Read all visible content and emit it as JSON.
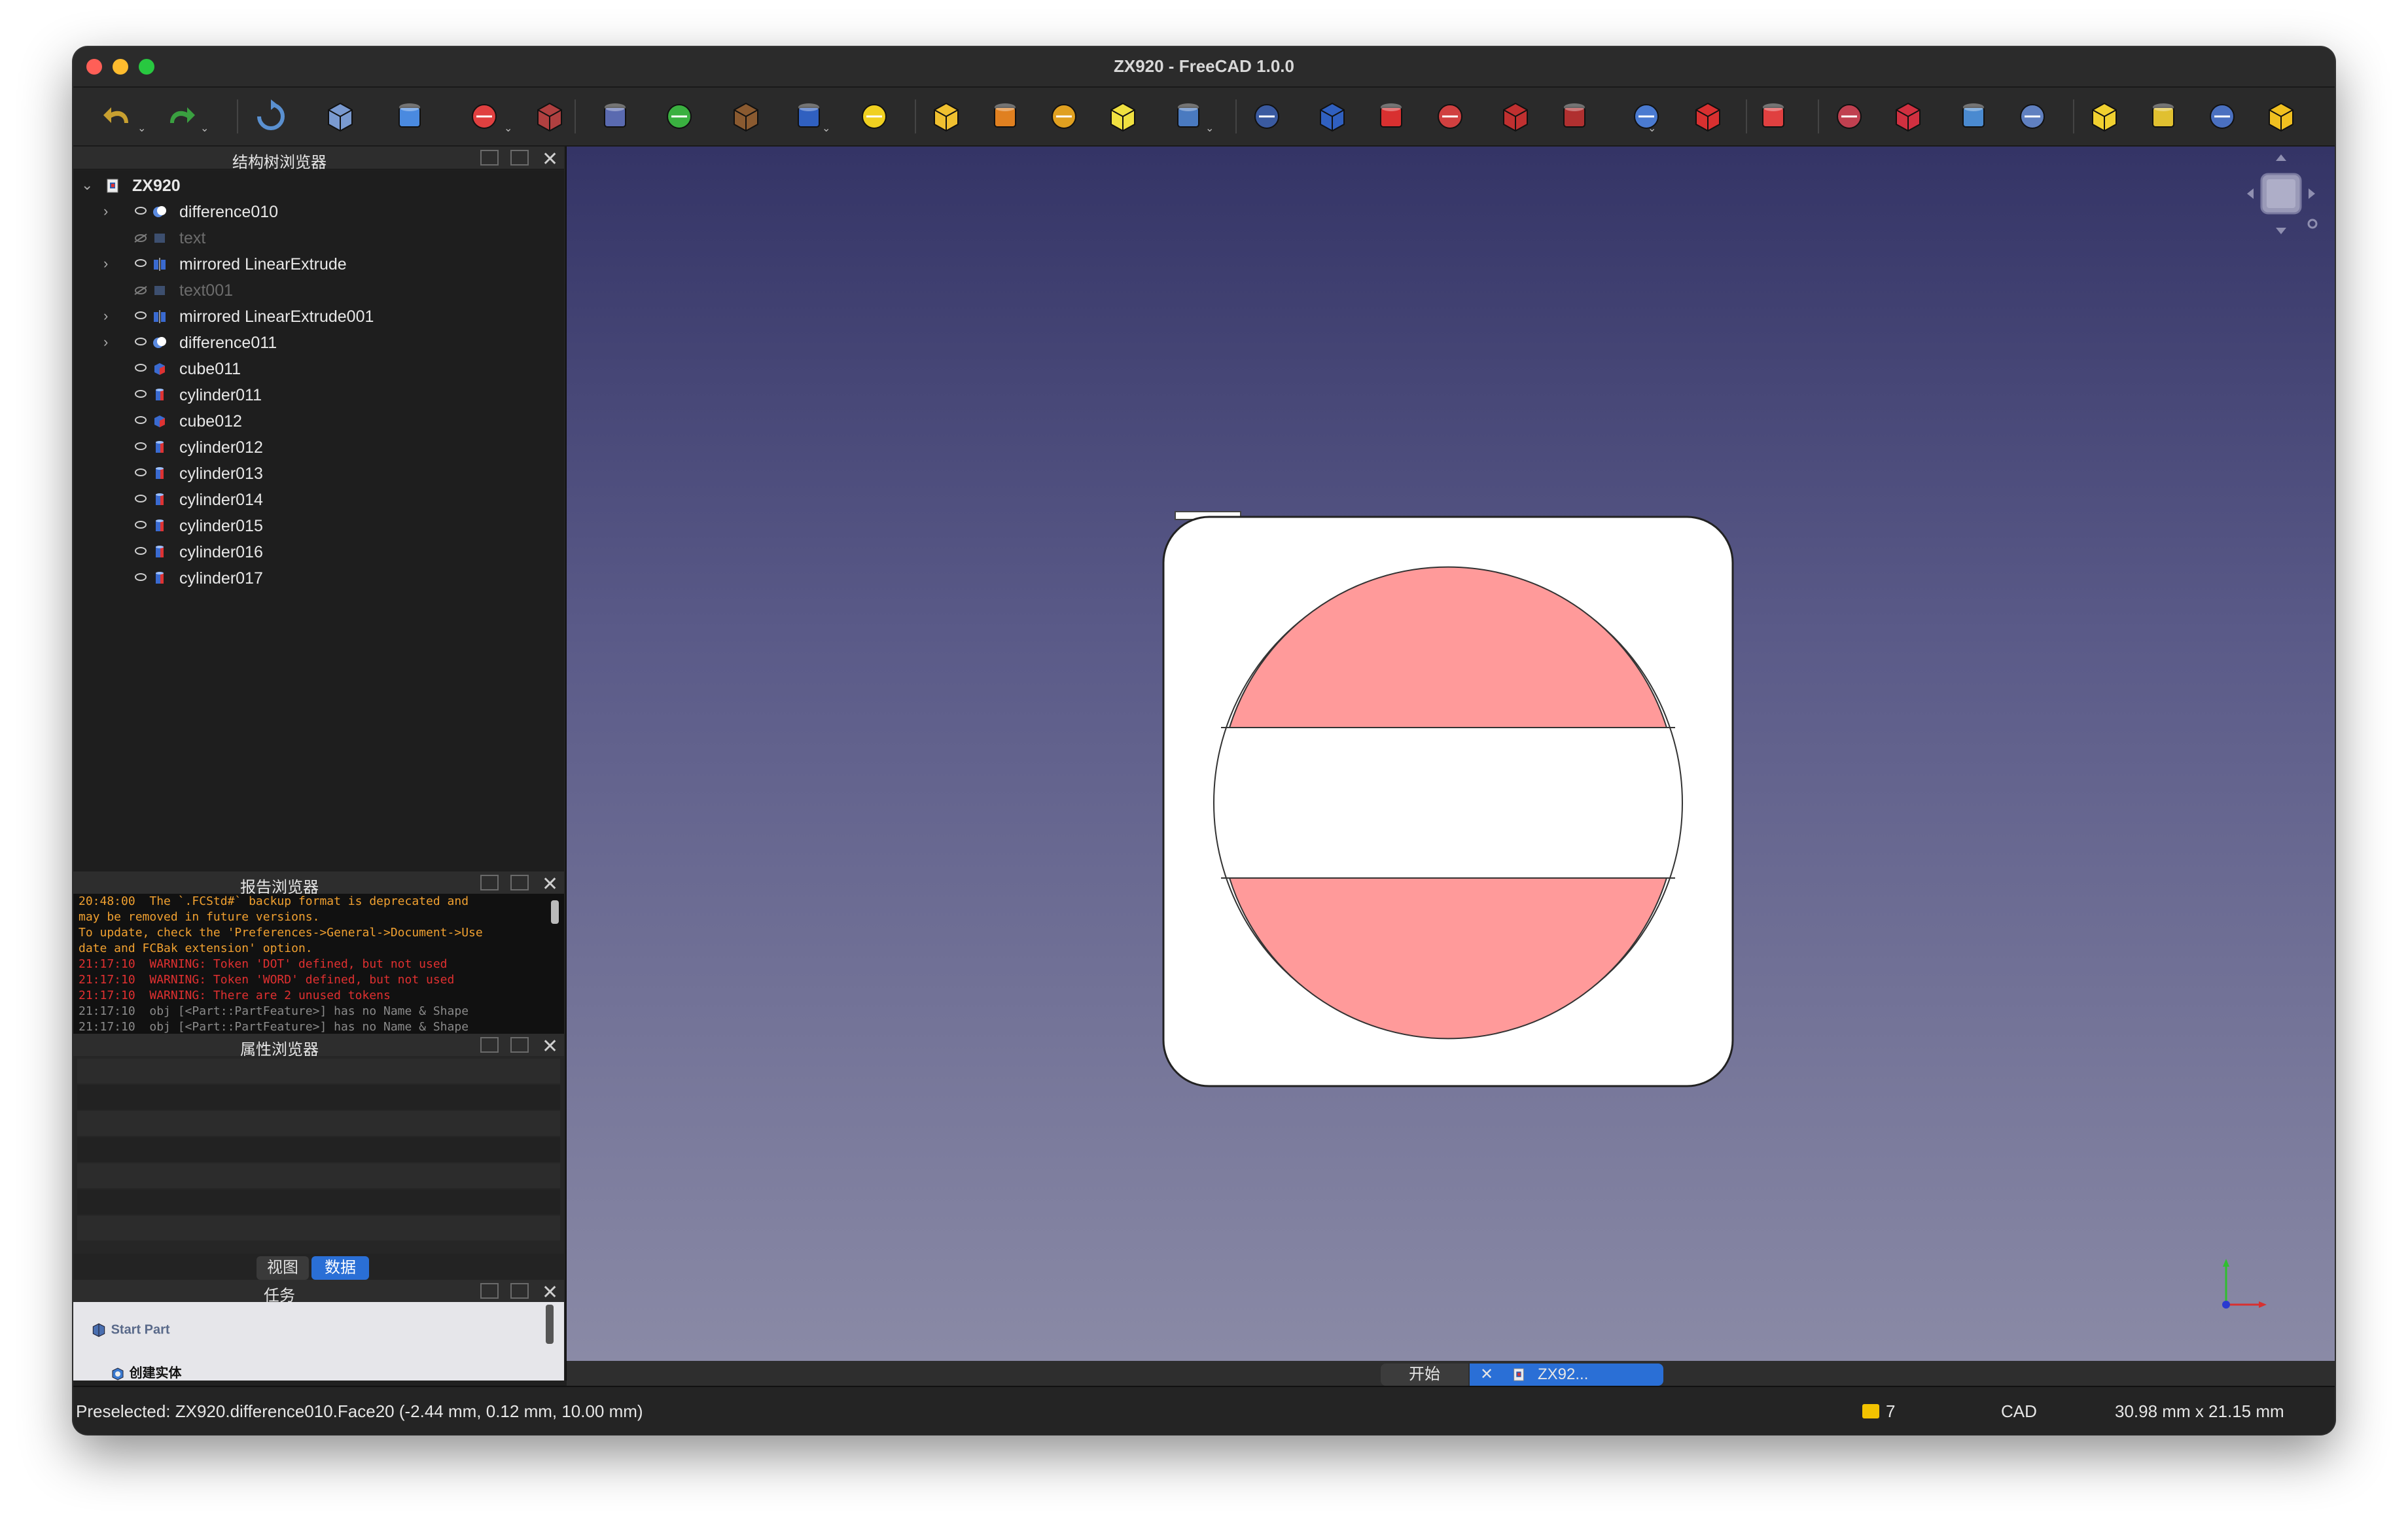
{
  "window": {
    "title": "ZX920 - FreeCAD 1.0.0"
  },
  "panels": {
    "tree_title": "结构树浏览器",
    "report_title": "报告浏览器",
    "property_title": "属性浏览器",
    "tasks_title": "任务"
  },
  "tree": {
    "root": "ZX920",
    "items": [
      {
        "label": "difference010",
        "expandable": true,
        "visible": true,
        "icon": "difference-icon"
      },
      {
        "label": "text",
        "expandable": false,
        "visible": false,
        "icon": "text-icon"
      },
      {
        "label": "mirrored LinearExtrude",
        "expandable": true,
        "visible": true,
        "icon": "mirror-icon"
      },
      {
        "label": "text001",
        "expandable": false,
        "visible": false,
        "icon": "text-icon"
      },
      {
        "label": "mirrored LinearExtrude001",
        "expandable": true,
        "visible": true,
        "icon": "mirror-icon"
      },
      {
        "label": "difference011",
        "expandable": true,
        "visible": true,
        "icon": "difference-icon"
      },
      {
        "label": "cube011",
        "expandable": false,
        "visible": true,
        "icon": "cube-icon"
      },
      {
        "label": "cylinder011",
        "expandable": false,
        "visible": true,
        "icon": "cylinder-icon"
      },
      {
        "label": "cube012",
        "expandable": false,
        "visible": true,
        "icon": "cube-icon"
      },
      {
        "label": "cylinder012",
        "expandable": false,
        "visible": true,
        "icon": "cylinder-icon"
      },
      {
        "label": "cylinder013",
        "expandable": false,
        "visible": true,
        "icon": "cylinder-icon"
      },
      {
        "label": "cylinder014",
        "expandable": false,
        "visible": true,
        "icon": "cylinder-icon"
      },
      {
        "label": "cylinder015",
        "expandable": false,
        "visible": true,
        "icon": "cylinder-icon"
      },
      {
        "label": "cylinder016",
        "expandable": false,
        "visible": true,
        "icon": "cylinder-icon"
      },
      {
        "label": "cylinder017",
        "expandable": false,
        "visible": true,
        "icon": "cylinder-icon"
      }
    ]
  },
  "report": {
    "lines": [
      {
        "text": "20:48:00  The `.FCStd#` backup format is deprecated and",
        "level": "warn"
      },
      {
        "text": "may be removed in future versions.",
        "level": "warn"
      },
      {
        "text": "To update, check the 'Preferences->General->Document->Use",
        "level": "warn"
      },
      {
        "text": "date and FCBak extension' option.",
        "level": "warn"
      },
      {
        "text": "21:17:10  WARNING: Token 'DOT' defined, but not used",
        "level": "error"
      },
      {
        "text": "21:17:10  WARNING: Token 'WORD' defined, but not used",
        "level": "error"
      },
      {
        "text": "21:17:10  WARNING: There are 2 unused tokens",
        "level": "error"
      },
      {
        "text": "21:17:10  obj [<Part::PartFeature>] has no Name & Shape",
        "level": "log"
      },
      {
        "text": "21:17:10  obj [<Part::PartFeature>] has no Name & Shape",
        "level": "log"
      }
    ]
  },
  "property_tabs": [
    "视图",
    "数据"
  ],
  "property_active_tab": "数据",
  "tasks": {
    "items": [
      "Start Part",
      "创建实体"
    ]
  },
  "doc_tabs": {
    "start": "开始",
    "document": "ZX92..."
  },
  "statusbar": {
    "preselected": "Preselected: ZX920.difference010.Face20 (-2.44 mm, 0.12 mm, 10.00 mm)",
    "count": "7",
    "nav_style": "CAD",
    "dimensions": "30.98 mm x 21.15 mm"
  },
  "colors": {
    "viewport_top": "#343466",
    "viewport_bottom": "#8a8aa6",
    "sign_face": "#ff9a9a",
    "accent": "#2a6fd6"
  },
  "toolbar_icons": [
    "undo-icon",
    "redo-icon",
    "refresh-icon",
    "whats-this-icon",
    "workbench-icon",
    "box-selection-icon",
    "selection-filter-icon",
    "part-icon",
    "pawn-icon",
    "material-icon",
    "llama-icon",
    "sketch-icon",
    "extrude-icon",
    "revolve-icon",
    "mirror-icon",
    "fillet-icon",
    "loft-icon",
    "primitives-icon",
    "shape-builder-icon",
    "cylinder-part-icon",
    "sweep-icon",
    "section-icon",
    "cross-sections-icon",
    "offset-icon",
    "thickness-icon",
    "boolean-icon",
    "cut-icon",
    "fuse-icon",
    "common-icon",
    "check-geometry-icon",
    "compound-icon",
    "explode-compound-icon",
    "compound-filter-icon",
    "attach-icon"
  ]
}
